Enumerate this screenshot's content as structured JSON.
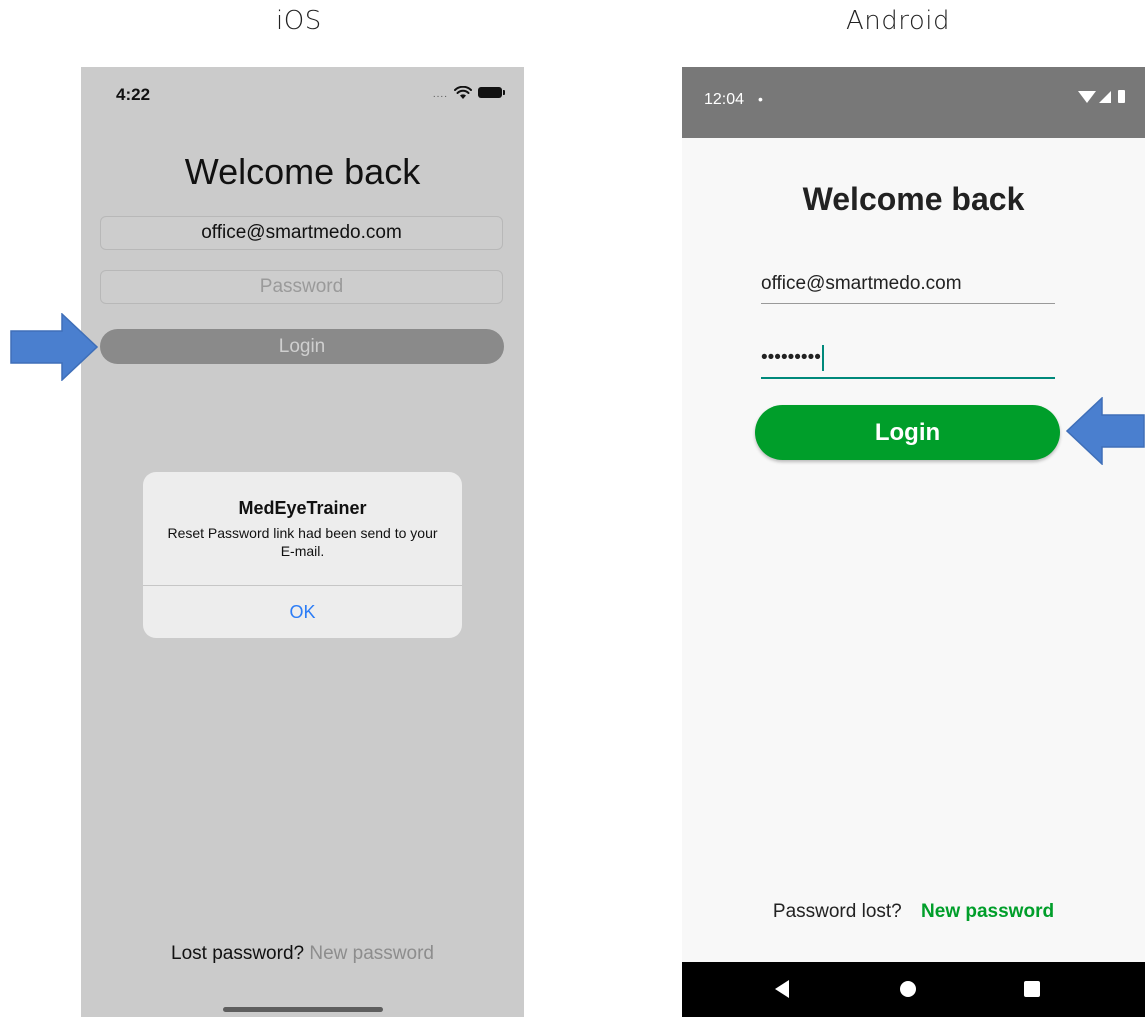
{
  "captions": {
    "ios": "iOS",
    "android": "Android"
  },
  "ios": {
    "status": {
      "time": "4:22",
      "signal_dots": "....",
      "wifi_icon": "wifi-icon",
      "battery_icon": "battery-icon"
    },
    "title": "Welcome back",
    "email_value": "office@smartmedo.com",
    "password_placeholder": "Password",
    "login_label": "Login",
    "alert": {
      "title": "MedEyeTrainer",
      "message": "Reset Password link had been send to your E-mail.",
      "ok_label": "OK"
    },
    "footer": {
      "lost_text": "Lost password?",
      "new_password_link": "New password"
    }
  },
  "android": {
    "status": {
      "time": "12:04",
      "dot": "•",
      "icons": [
        "wifi-icon",
        "signal-icon",
        "battery-icon"
      ]
    },
    "title": "Welcome back",
    "email_value": "office@smartmedo.com",
    "password_value": "•••••••••",
    "login_label": "Login",
    "footer": {
      "lost_text": "Password lost?",
      "new_password_link": "New password"
    },
    "nav": [
      "back-icon",
      "home-icon",
      "recents-icon"
    ]
  },
  "colors": {
    "ios_overlay_bg": "#cbcbcb",
    "ios_alert_button": "#2b7cf6",
    "android_primary_green": "#009e2a",
    "android_accent_teal": "#00897b",
    "arrow_blue": "#4a7fcf"
  }
}
